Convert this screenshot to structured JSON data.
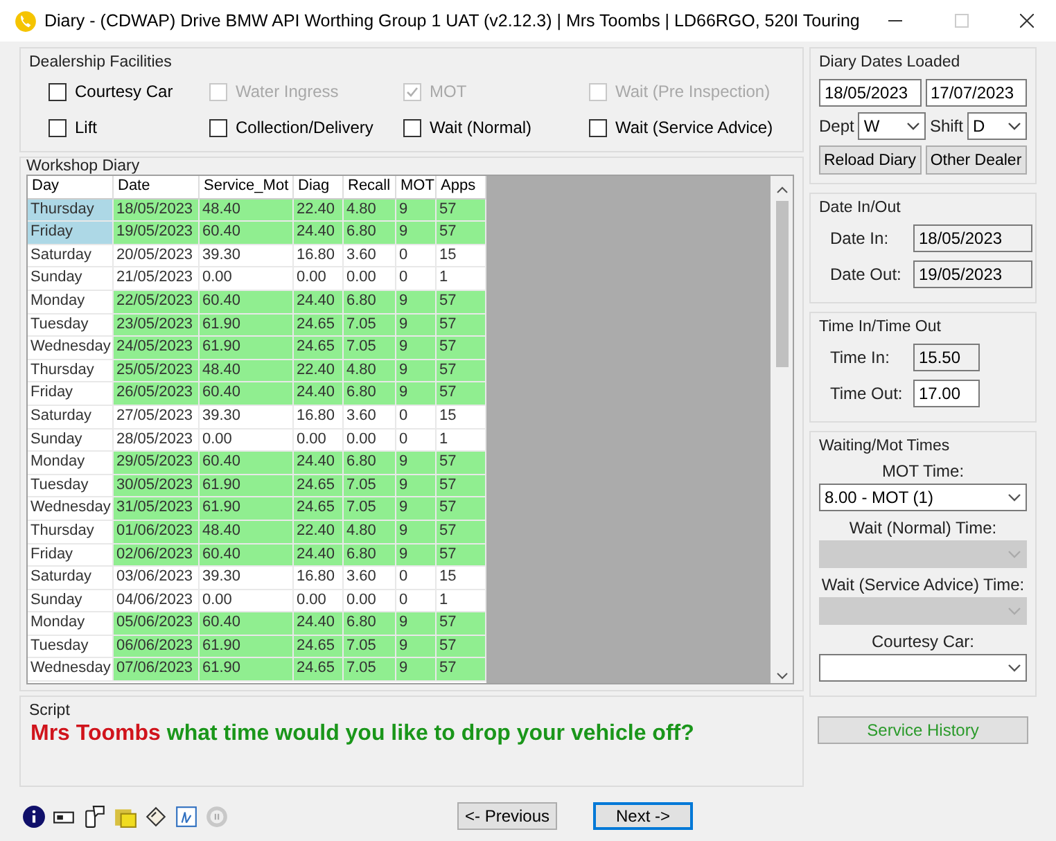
{
  "window": {
    "title": "Diary - (CDWAP) Drive BMW API Worthing Group 1 UAT  (v2.12.3) | Mrs Toombs | LD66RGO, 520I Touring"
  },
  "facilities": {
    "title": "Dealership Facilities",
    "options": [
      {
        "label": "Courtesy Car",
        "checked": false,
        "disabled": false
      },
      {
        "label": "Water Ingress",
        "checked": false,
        "disabled": true
      },
      {
        "label": "MOT",
        "checked": true,
        "disabled": true
      },
      {
        "label": "Wait (Pre Inspection)",
        "checked": false,
        "disabled": true
      },
      {
        "label": "Lift",
        "checked": false,
        "disabled": false
      },
      {
        "label": "Collection/Delivery",
        "checked": false,
        "disabled": false
      },
      {
        "label": "Wait (Normal)",
        "checked": false,
        "disabled": false
      },
      {
        "label": "Wait (Service Advice)",
        "checked": false,
        "disabled": false
      }
    ]
  },
  "diary": {
    "title": "Workshop Diary",
    "columns": [
      "Day",
      "Date",
      "Service_Mot",
      "Diag",
      "Recall",
      "MOT",
      "Apps"
    ],
    "rows": [
      {
        "cells": [
          "Thursday",
          "18/05/2023",
          "48.40",
          "22.40",
          "4.80",
          "9",
          "57"
        ],
        "highlighted": true,
        "selected": true
      },
      {
        "cells": [
          "Friday",
          "19/05/2023",
          "60.40",
          "24.40",
          "6.80",
          "9",
          "57"
        ],
        "highlighted": true,
        "selected": true
      },
      {
        "cells": [
          "Saturday",
          "20/05/2023",
          "39.30",
          "16.80",
          "3.60",
          "0",
          "15"
        ],
        "highlighted": false,
        "selected": false
      },
      {
        "cells": [
          "Sunday",
          "21/05/2023",
          "0.00",
          "0.00",
          "0.00",
          "0",
          "1"
        ],
        "highlighted": false,
        "selected": false
      },
      {
        "cells": [
          "Monday",
          "22/05/2023",
          "60.40",
          "24.40",
          "6.80",
          "9",
          "57"
        ],
        "highlighted": true,
        "selected": false
      },
      {
        "cells": [
          "Tuesday",
          "23/05/2023",
          "61.90",
          "24.65",
          "7.05",
          "9",
          "57"
        ],
        "highlighted": true,
        "selected": false
      },
      {
        "cells": [
          "Wednesday",
          "24/05/2023",
          "61.90",
          "24.65",
          "7.05",
          "9",
          "57"
        ],
        "highlighted": true,
        "selected": false
      },
      {
        "cells": [
          "Thursday",
          "25/05/2023",
          "48.40",
          "22.40",
          "4.80",
          "9",
          "57"
        ],
        "highlighted": true,
        "selected": false
      },
      {
        "cells": [
          "Friday",
          "26/05/2023",
          "60.40",
          "24.40",
          "6.80",
          "9",
          "57"
        ],
        "highlighted": true,
        "selected": false
      },
      {
        "cells": [
          "Saturday",
          "27/05/2023",
          "39.30",
          "16.80",
          "3.60",
          "0",
          "15"
        ],
        "highlighted": false,
        "selected": false
      },
      {
        "cells": [
          "Sunday",
          "28/05/2023",
          "0.00",
          "0.00",
          "0.00",
          "0",
          "1"
        ],
        "highlighted": false,
        "selected": false
      },
      {
        "cells": [
          "Monday",
          "29/05/2023",
          "60.40",
          "24.40",
          "6.80",
          "9",
          "57"
        ],
        "highlighted": true,
        "selected": false
      },
      {
        "cells": [
          "Tuesday",
          "30/05/2023",
          "61.90",
          "24.65",
          "7.05",
          "9",
          "57"
        ],
        "highlighted": true,
        "selected": false
      },
      {
        "cells": [
          "Wednesday",
          "31/05/2023",
          "61.90",
          "24.65",
          "7.05",
          "9",
          "57"
        ],
        "highlighted": true,
        "selected": false
      },
      {
        "cells": [
          "Thursday",
          "01/06/2023",
          "48.40",
          "22.40",
          "4.80",
          "9",
          "57"
        ],
        "highlighted": true,
        "selected": false
      },
      {
        "cells": [
          "Friday",
          "02/06/2023",
          "60.40",
          "24.40",
          "6.80",
          "9",
          "57"
        ],
        "highlighted": true,
        "selected": false
      },
      {
        "cells": [
          "Saturday",
          "03/06/2023",
          "39.30",
          "16.80",
          "3.60",
          "0",
          "15"
        ],
        "highlighted": false,
        "selected": false
      },
      {
        "cells": [
          "Sunday",
          "04/06/2023",
          "0.00",
          "0.00",
          "0.00",
          "0",
          "1"
        ],
        "highlighted": false,
        "selected": false
      },
      {
        "cells": [
          "Monday",
          "05/06/2023",
          "60.40",
          "24.40",
          "6.80",
          "9",
          "57"
        ],
        "highlighted": true,
        "selected": false
      },
      {
        "cells": [
          "Tuesday",
          "06/06/2023",
          "61.90",
          "24.65",
          "7.05",
          "9",
          "57"
        ],
        "highlighted": true,
        "selected": false
      },
      {
        "cells": [
          "Wednesday",
          "07/06/2023",
          "61.90",
          "24.65",
          "7.05",
          "9",
          "57"
        ],
        "highlighted": true,
        "selected": false
      }
    ]
  },
  "script": {
    "title": "Script",
    "name": "Mrs Toombs",
    "message": "what time would you like to drop your vehicle off?"
  },
  "nav": {
    "previous": "<- Previous",
    "next": "Next ->"
  },
  "dates_loaded": {
    "title": "Diary Dates Loaded",
    "from": "18/05/2023",
    "to": "17/07/2023",
    "dept_label": "Dept",
    "dept": "W",
    "shift_label": "Shift",
    "shift": "D",
    "buttons": [
      "Reload Diary",
      "Other Dealer"
    ]
  },
  "date_in_out": {
    "title": "Date In/Out",
    "fields": [
      {
        "label": "Date In:",
        "value": "18/05/2023",
        "readonly": true
      },
      {
        "label": "Date Out:",
        "value": "19/05/2023",
        "readonly": true
      }
    ]
  },
  "time_in_out": {
    "title": "Time In/Time Out",
    "fields": [
      {
        "label": "Time In:",
        "value": "15.50",
        "readonly": true
      },
      {
        "label": "Time Out:",
        "value": "17.00",
        "readonly": false
      }
    ]
  },
  "waiting": {
    "title": "Waiting/Mot Times",
    "selects": [
      {
        "label": "MOT Time:",
        "value": "8.00 - MOT (1)",
        "disabled": false
      },
      {
        "label": "Wait (Normal) Time:",
        "disabled": true
      },
      {
        "label": "Wait (Service Advice) Time:",
        "disabled": true
      },
      {
        "label": "Courtesy Car:",
        "disabled": false
      }
    ]
  },
  "service_history": "Service History"
}
